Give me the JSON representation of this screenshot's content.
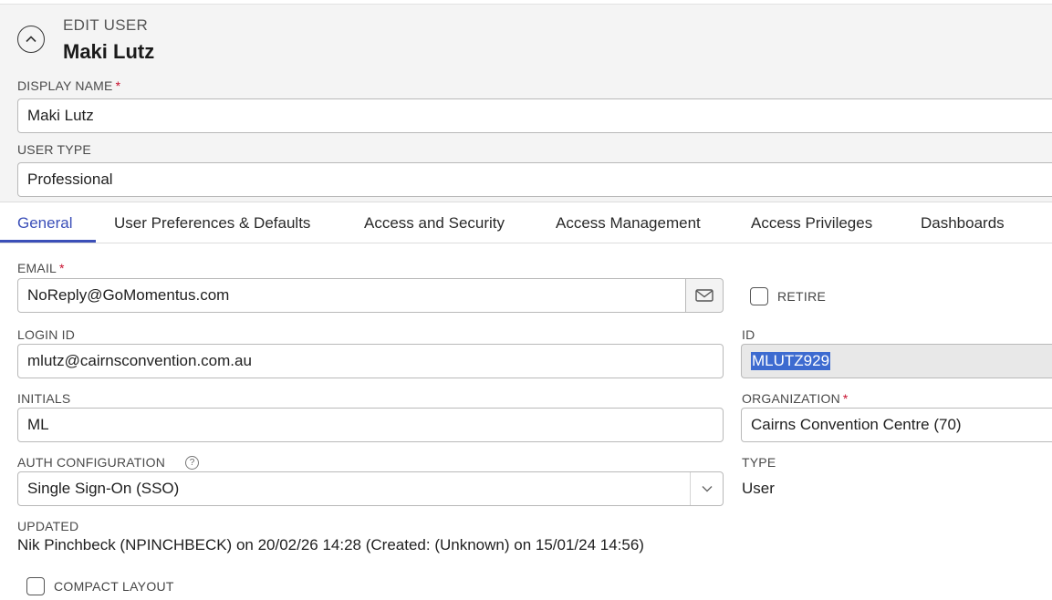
{
  "header": {
    "edit_label": "EDIT USER",
    "user_name": "Maki Lutz",
    "display_name_label": "DISPLAY NAME",
    "display_name_value": "Maki Lutz",
    "user_type_label": "USER TYPE",
    "user_type_value": "Professional"
  },
  "required_marker": "*",
  "tabs": [
    {
      "label": "General",
      "active": true
    },
    {
      "label": "User Preferences & Defaults"
    },
    {
      "label": "Access and Security"
    },
    {
      "label": "Access Management"
    },
    {
      "label": "Access Privileges"
    },
    {
      "label": "Dashboards"
    }
  ],
  "form": {
    "email_label": "EMAIL",
    "email_value": "NoReply@GoMomentus.com",
    "retire_label": "RETIRE",
    "login_id_label": "LOGIN ID",
    "login_id_value": "mlutz@cairnsconvention.com.au",
    "id_label": "ID",
    "id_value": "MLUTZ929",
    "initials_label": "INITIALS",
    "initials_value": "ML",
    "organization_label": "ORGANIZATION",
    "organization_value": "Cairns Convention Centre (70)",
    "auth_label": "AUTH CONFIGURATION",
    "auth_help_icon": "?",
    "auth_value": "Single Sign-On (SSO)",
    "type_label": "TYPE",
    "type_value": "User",
    "updated_label": "UPDATED",
    "updated_value": "Nik Pinchbeck (NPINCHBECK) on 20/02/26 14:28 (Created: (Unknown) on 15/01/24 14:56)",
    "compact_layout_label": "COMPACT LAYOUT"
  },
  "colors": {
    "accent": "#3b4fb8",
    "required": "#c8102e",
    "selection": "#3d6bd0",
    "header_bg": "#f4f4f4"
  }
}
